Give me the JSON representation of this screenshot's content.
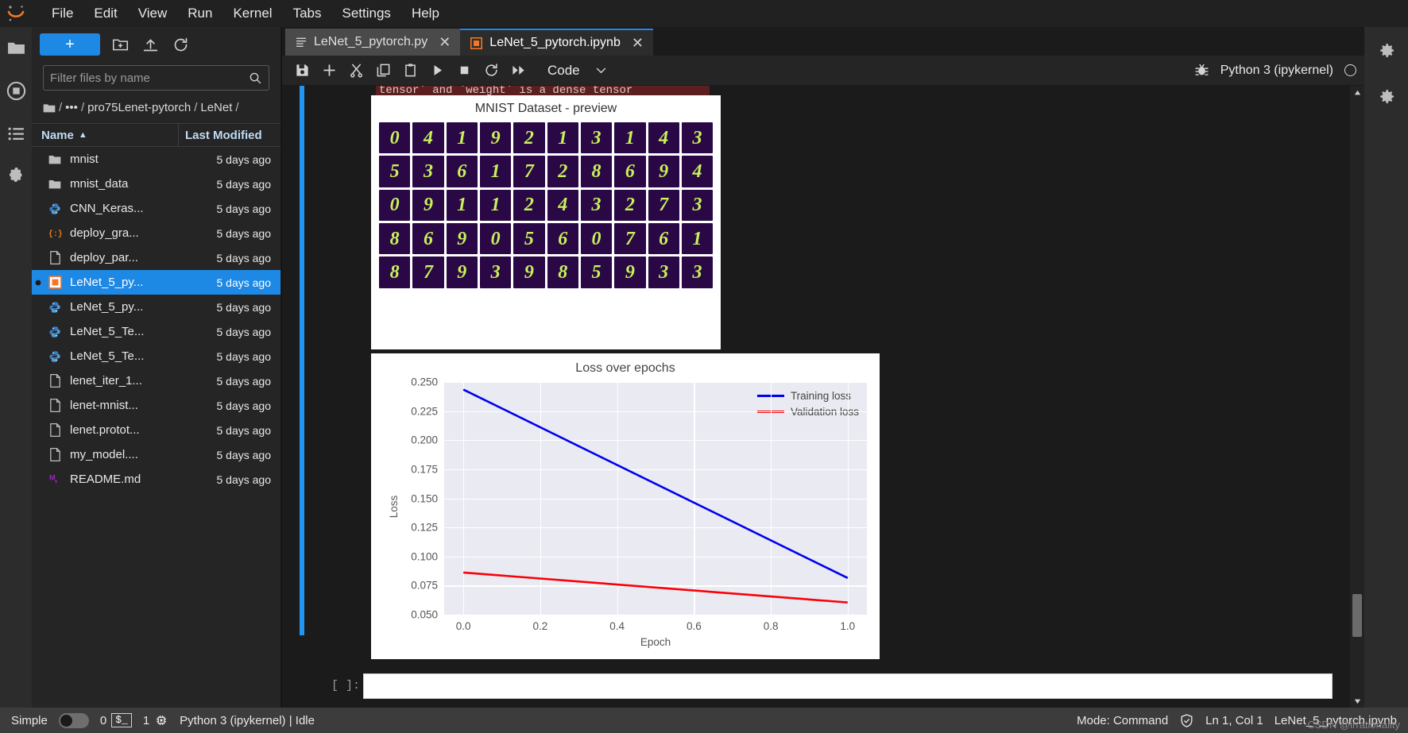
{
  "app": {
    "logo_icon": "jupyter-logo-icon",
    "menu": [
      "File",
      "Edit",
      "View",
      "Run",
      "Kernel",
      "Tabs",
      "Settings",
      "Help"
    ]
  },
  "activity_bar": {
    "items": [
      {
        "icon": "folder-icon",
        "name": "file-browser"
      },
      {
        "icon": "running-terminals-icon",
        "name": "running-sessions"
      },
      {
        "icon": "list-icon",
        "name": "table-of-contents"
      },
      {
        "icon": "puzzle-icon",
        "name": "extension-manager"
      }
    ]
  },
  "right_bar": {
    "items": [
      {
        "icon": "gear-icon",
        "name": "property-inspector"
      },
      {
        "icon": "gear-icon",
        "name": "debugger-panel"
      }
    ]
  },
  "file_browser": {
    "new_launcher_label": "+",
    "toolbar_icons": [
      "new-folder-icon",
      "upload-icon",
      "refresh-icon"
    ],
    "filter": {
      "value": "",
      "placeholder": "Filter files by name",
      "icon": "search-icon"
    },
    "breadcrumb": [
      "/",
      "•••",
      "/",
      "pro75Lenet-pytorch",
      "/",
      "LeNet",
      "/"
    ],
    "columns": {
      "name": "Name",
      "last_modified": "Last Modified",
      "sort_indicator": "▲"
    },
    "files": [
      {
        "name": "mnist",
        "modified": "5 days ago",
        "icon": "folder-icon",
        "selected": false,
        "running": false
      },
      {
        "name": "mnist_data",
        "modified": "5 days ago",
        "icon": "folder-icon",
        "selected": false,
        "running": false
      },
      {
        "name": "CNN_Keras...",
        "modified": "5 days ago",
        "icon": "python-icon",
        "selected": false,
        "running": false
      },
      {
        "name": "deploy_gra...",
        "modified": "5 days ago",
        "icon": "json-icon",
        "selected": false,
        "running": false
      },
      {
        "name": "deploy_par...",
        "modified": "5 days ago",
        "icon": "file-icon",
        "selected": false,
        "running": false
      },
      {
        "name": "LeNet_5_py...",
        "modified": "5 days ago",
        "icon": "notebook-icon",
        "selected": true,
        "running": true
      },
      {
        "name": "LeNet_5_py...",
        "modified": "5 days ago",
        "icon": "python-icon",
        "selected": false,
        "running": false
      },
      {
        "name": "LeNet_5_Te...",
        "modified": "5 days ago",
        "icon": "python-icon",
        "selected": false,
        "running": false
      },
      {
        "name": "LeNet_5_Te...",
        "modified": "5 days ago",
        "icon": "python-icon",
        "selected": false,
        "running": false
      },
      {
        "name": "lenet_iter_1...",
        "modified": "5 days ago",
        "icon": "file-icon",
        "selected": false,
        "running": false
      },
      {
        "name": "lenet-mnist...",
        "modified": "5 days ago",
        "icon": "file-icon",
        "selected": false,
        "running": false
      },
      {
        "name": "lenet.protot...",
        "modified": "5 days ago",
        "icon": "file-icon",
        "selected": false,
        "running": false
      },
      {
        "name": "my_model....",
        "modified": "5 days ago",
        "icon": "file-icon",
        "selected": false,
        "running": false
      },
      {
        "name": "README.md",
        "modified": "5 days ago",
        "icon": "markdown-icon",
        "selected": false,
        "running": false
      }
    ]
  },
  "dock": {
    "tabs": [
      {
        "label": "LeNet_5_pytorch.py",
        "icon": "text-file-icon",
        "active": false,
        "closable": true
      },
      {
        "label": "LeNet_5_pytorch.ipynb",
        "icon": "notebook-icon",
        "active": true,
        "closable": true
      }
    ]
  },
  "notebook_toolbar": {
    "buttons": [
      {
        "icon": "save-icon",
        "name": "save-button"
      },
      {
        "icon": "plus-icon",
        "name": "insert-cell-button"
      },
      {
        "icon": "cut-icon",
        "name": "cut-cell-button"
      },
      {
        "icon": "copy-icon",
        "name": "copy-cell-button"
      },
      {
        "icon": "paste-icon",
        "name": "paste-cell-button"
      },
      {
        "icon": "run-icon",
        "name": "run-cell-button"
      },
      {
        "icon": "stop-icon",
        "name": "interrupt-kernel-button"
      },
      {
        "icon": "restart-icon",
        "name": "restart-kernel-button"
      },
      {
        "icon": "fast-forward-icon",
        "name": "restart-and-run-all-button"
      }
    ],
    "cell_type": {
      "value": "Code",
      "caret": "⌄"
    },
    "debugger_icon": "bug-icon",
    "kernel_name": "Python 3 (ipykernel)",
    "kernel_status": "idle"
  },
  "notebook": {
    "warning_text": "tensor` and `weight` is a dense tensor",
    "empty_cell_prompt": "[ ]:",
    "mnist_preview": {
      "title": "MNIST Dataset - preview",
      "rows": [
        [
          "0",
          "4",
          "1",
          "9",
          "2",
          "1",
          "3",
          "1",
          "4",
          "3"
        ],
        [
          "5",
          "3",
          "6",
          "1",
          "7",
          "2",
          "8",
          "6",
          "9",
          "4"
        ],
        [
          "0",
          "9",
          "1",
          "1",
          "2",
          "4",
          "3",
          "2",
          "7",
          "3"
        ],
        [
          "8",
          "6",
          "9",
          "0",
          "5",
          "6",
          "0",
          "7",
          "6",
          "1"
        ],
        [
          "8",
          "7",
          "9",
          "3",
          "9",
          "8",
          "5",
          "9",
          "3",
          "3"
        ]
      ]
    }
  },
  "chart_data": {
    "type": "line",
    "title": "Loss over epochs",
    "xlabel": "Epoch",
    "ylabel": "Loss",
    "xlim": [
      -0.05,
      1.05
    ],
    "ylim": [
      0.05,
      0.25
    ],
    "xticks": [
      "0.0",
      "0.2",
      "0.4",
      "0.6",
      "0.8",
      "1.0"
    ],
    "xtick_values": [
      0.0,
      0.2,
      0.4,
      0.6,
      0.8,
      1.0
    ],
    "yticks": [
      "0.050",
      "0.075",
      "0.100",
      "0.125",
      "0.150",
      "0.175",
      "0.200",
      "0.225",
      "0.250"
    ],
    "ytick_values": [
      0.05,
      0.075,
      0.1,
      0.125,
      0.15,
      0.175,
      0.2,
      0.225,
      0.25
    ],
    "grid": true,
    "legend_position": "upper right",
    "x": [
      0.0,
      1.0
    ],
    "series": [
      {
        "name": "Training loss",
        "color": "#0000ee",
        "values": [
          0.2435,
          0.0815
        ]
      },
      {
        "name": "Validation loss",
        "color": "#fb0007",
        "values": [
          0.0862,
          0.0605
        ]
      }
    ]
  },
  "status_bar": {
    "simple_label": "Simple",
    "simple_enabled": false,
    "terminal_count": "0",
    "terminal_icon": "$_",
    "kernel_count": "1",
    "kernel_icon": "chip-icon",
    "kernel_status_text": "Python 3 (ipykernel) | Idle",
    "mode_label": "Mode: Command",
    "trust_icon": "shield-check-icon",
    "cursor_position": "Ln 1, Col 1",
    "file_name": "LeNet_5_pytorch.ipynb"
  },
  "watermark": {
    "line1": "CSDN @irrationality",
    "line2": "LeNet_5_pytorch.ipynb"
  },
  "colors": {
    "accent": "#1e88e5",
    "training_loss": "#0000ee",
    "validation_loss": "#fb0007",
    "plot_bg": "#eaeaf2",
    "digit_bg": "#2a0845",
    "digit_fg": "#c9f25a"
  }
}
